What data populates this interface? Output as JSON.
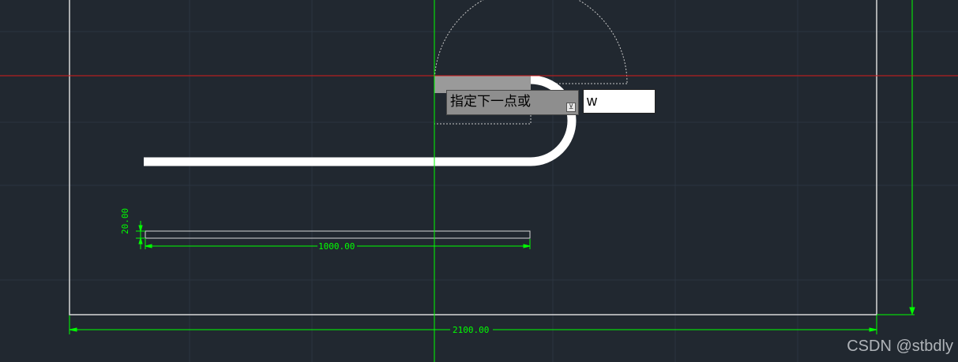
{
  "canvas": {
    "background": "#212830",
    "grid_color": "#2c3540",
    "crosshair_h_color": "#d61c1c",
    "crosshair_v_color": "#00ff00"
  },
  "dimensions": {
    "overall_width": "2100.00",
    "rect_length": "1000.00",
    "rect_height": "20.00"
  },
  "command": {
    "prompt": "指定下一点或",
    "dropdown_icon": "down-arrow-icon",
    "input_value": "w"
  },
  "watermark": "CSDN @stbdly"
}
